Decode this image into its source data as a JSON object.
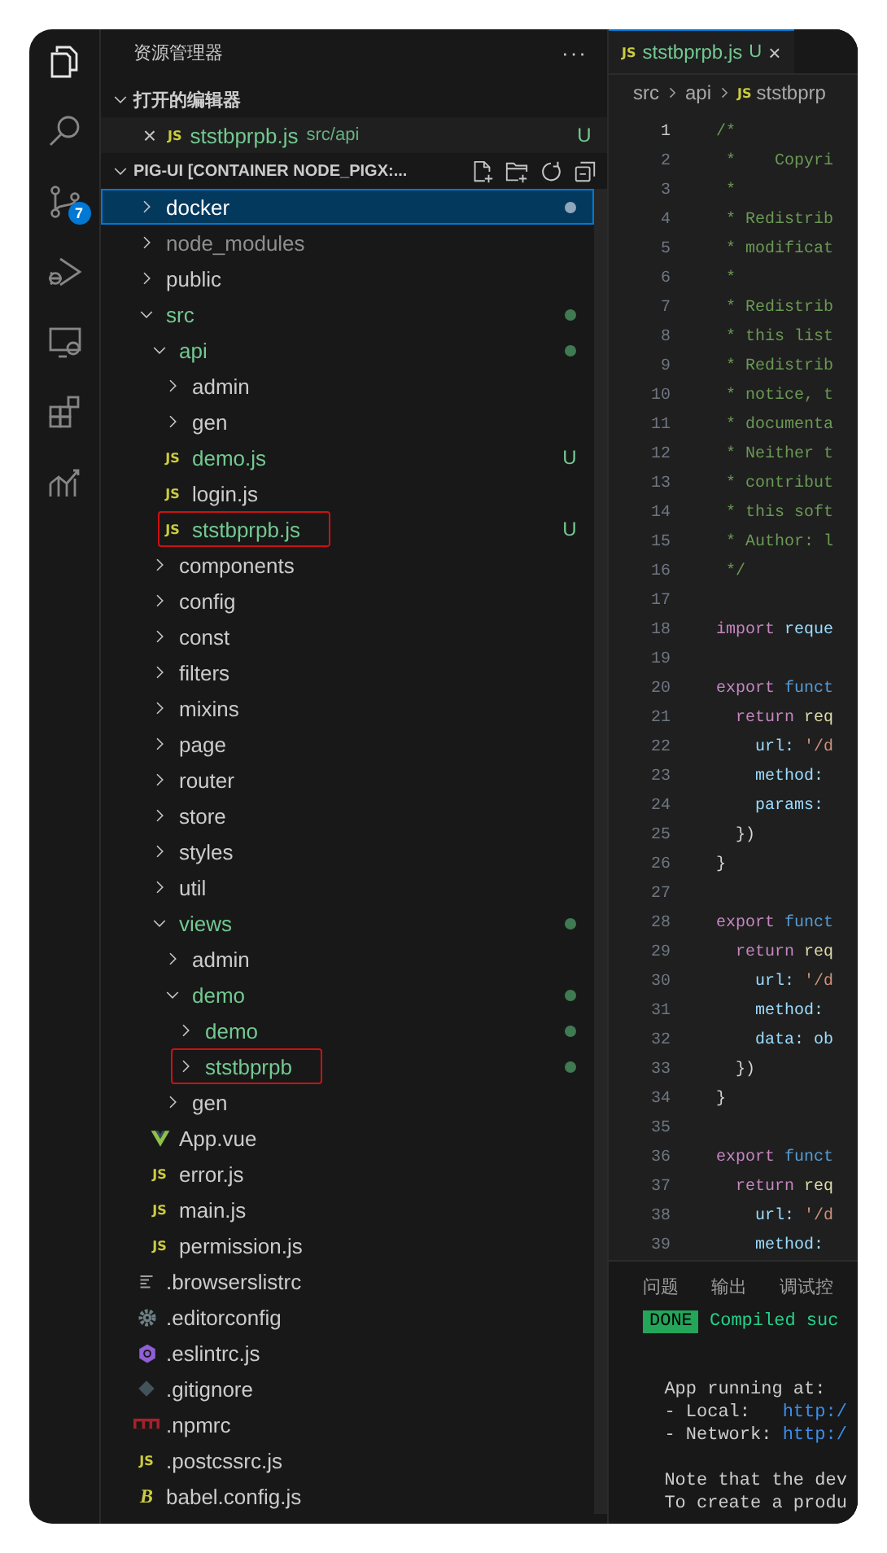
{
  "activity_bar": [
    {
      "kind": "files",
      "selected": true
    },
    {
      "kind": "search",
      "selected": false
    },
    {
      "kind": "scm",
      "selected": false,
      "badge": "7"
    },
    {
      "kind": "debug",
      "selected": false
    },
    {
      "kind": "remote",
      "selected": false
    },
    {
      "kind": "extensions",
      "selected": false
    },
    {
      "kind": "chart",
      "selected": false
    }
  ],
  "explorer": {
    "title": "资源管理器",
    "more": "···",
    "open_editors": {
      "title": "打开的编辑器",
      "expanded": true,
      "items": [
        {
          "close": "×",
          "icon_label": "JS",
          "name": "ststbprpb.js",
          "path": "src/api",
          "badge": "U"
        }
      ]
    },
    "root": {
      "title": "PIG-UI [CONTAINER NODE_PIGX:...",
      "expanded": true
    },
    "tree": [
      {
        "name": "docker",
        "kind": "folder",
        "expanded": false,
        "untracked": false,
        "ignored": false,
        "selected": true,
        "highlighted": false,
        "dot": true
      },
      {
        "name": "node_modules",
        "kind": "folder",
        "expanded": false,
        "untracked": false,
        "ignored": true,
        "selected": false,
        "highlighted": false,
        "dot": false
      },
      {
        "name": "public",
        "kind": "folder",
        "expanded": false,
        "untracked": false,
        "ignored": false,
        "selected": false,
        "highlighted": false,
        "dot": false
      },
      {
        "name": "src",
        "kind": "folder",
        "expanded": true,
        "untracked": true,
        "ignored": false,
        "selected": false,
        "highlighted": false,
        "dot": true,
        "children": [
          {
            "name": "api",
            "kind": "folder",
            "expanded": true,
            "untracked": true,
            "ignored": false,
            "selected": false,
            "highlighted": false,
            "dot": true,
            "children": [
              {
                "name": "admin",
                "kind": "folder",
                "expanded": false,
                "untracked": false,
                "ignored": false,
                "selected": false,
                "highlighted": false,
                "dot": false
              },
              {
                "name": "gen",
                "kind": "folder",
                "expanded": false,
                "untracked": false,
                "ignored": false,
                "selected": false,
                "highlighted": false,
                "dot": false
              },
              {
                "name": "demo.js",
                "kind": "js",
                "icon_label": "JS",
                "untracked": true,
                "ignored": false,
                "badge": "U",
                "selected": false,
                "highlighted": false,
                "dot": false
              },
              {
                "name": "login.js",
                "kind": "js",
                "icon_label": "JS",
                "untracked": false,
                "ignored": false,
                "selected": false,
                "highlighted": false,
                "dot": false
              },
              {
                "name": "ststbprpb.js",
                "kind": "js",
                "icon_label": "JS",
                "untracked": true,
                "ignored": false,
                "badge": "U",
                "selected": false,
                "highlighted": true,
                "dot": false
              }
            ]
          },
          {
            "name": "components",
            "kind": "folder",
            "expanded": false,
            "untracked": false,
            "ignored": false,
            "selected": false,
            "highlighted": false,
            "dot": false
          },
          {
            "name": "config",
            "kind": "folder",
            "expanded": false,
            "untracked": false,
            "ignored": false,
            "selected": false,
            "highlighted": false,
            "dot": false
          },
          {
            "name": "const",
            "kind": "folder",
            "expanded": false,
            "untracked": false,
            "ignored": false,
            "selected": false,
            "highlighted": false,
            "dot": false
          },
          {
            "name": "filters",
            "kind": "folder",
            "expanded": false,
            "untracked": false,
            "ignored": false,
            "selected": false,
            "highlighted": false,
            "dot": false
          },
          {
            "name": "mixins",
            "kind": "folder",
            "expanded": false,
            "untracked": false,
            "ignored": false,
            "selected": false,
            "highlighted": false,
            "dot": false
          },
          {
            "name": "page",
            "kind": "folder",
            "expanded": false,
            "untracked": false,
            "ignored": false,
            "selected": false,
            "highlighted": false,
            "dot": false
          },
          {
            "name": "router",
            "kind": "folder",
            "expanded": false,
            "untracked": false,
            "ignored": false,
            "selected": false,
            "highlighted": false,
            "dot": false
          },
          {
            "name": "store",
            "kind": "folder",
            "expanded": false,
            "untracked": false,
            "ignored": false,
            "selected": false,
            "highlighted": false,
            "dot": false
          },
          {
            "name": "styles",
            "kind": "folder",
            "expanded": false,
            "untracked": false,
            "ignored": false,
            "selected": false,
            "highlighted": false,
            "dot": false
          },
          {
            "name": "util",
            "kind": "folder",
            "expanded": false,
            "untracked": false,
            "ignored": false,
            "selected": false,
            "highlighted": false,
            "dot": false
          },
          {
            "name": "views",
            "kind": "folder",
            "expanded": true,
            "untracked": true,
            "ignored": false,
            "selected": false,
            "highlighted": false,
            "dot": true,
            "children": [
              {
                "name": "admin",
                "kind": "folder",
                "expanded": false,
                "untracked": false,
                "ignored": false,
                "selected": false,
                "highlighted": false,
                "dot": false
              },
              {
                "name": "demo",
                "kind": "folder",
                "expanded": true,
                "untracked": true,
                "ignored": false,
                "selected": false,
                "highlighted": false,
                "dot": true,
                "children": [
                  {
                    "name": "demo",
                    "kind": "folder",
                    "expanded": false,
                    "untracked": true,
                    "ignored": false,
                    "selected": false,
                    "highlighted": false,
                    "dot": true
                  },
                  {
                    "name": "ststbprpb",
                    "kind": "folder",
                    "expanded": false,
                    "untracked": true,
                    "ignored": false,
                    "selected": false,
                    "highlighted": true,
                    "dot": true
                  }
                ]
              },
              {
                "name": "gen",
                "kind": "folder",
                "expanded": false,
                "untracked": false,
                "ignored": false,
                "selected": false,
                "highlighted": false,
                "dot": false
              }
            ]
          },
          {
            "name": "App.vue",
            "kind": "vue",
            "untracked": false,
            "ignored": false,
            "selected": false,
            "highlighted": false,
            "dot": false
          },
          {
            "name": "error.js",
            "kind": "js",
            "icon_label": "JS",
            "untracked": false,
            "ignored": false,
            "selected": false,
            "highlighted": false,
            "dot": false
          },
          {
            "name": "main.js",
            "kind": "js",
            "icon_label": "JS",
            "untracked": false,
            "ignored": false,
            "selected": false,
            "highlighted": false,
            "dot": false
          },
          {
            "name": "permission.js",
            "kind": "js",
            "icon_label": "JS",
            "untracked": false,
            "ignored": false,
            "selected": false,
            "highlighted": false,
            "dot": false
          }
        ]
      },
      {
        "name": ".browserslistrc",
        "kind": "lines",
        "untracked": false,
        "ignored": false,
        "selected": false,
        "highlighted": false,
        "dot": false
      },
      {
        "name": ".editorconfig",
        "kind": "gear",
        "untracked": false,
        "ignored": false,
        "selected": false,
        "highlighted": false,
        "dot": false
      },
      {
        "name": ".eslintrc.js",
        "kind": "eslint",
        "untracked": false,
        "ignored": false,
        "selected": false,
        "highlighted": false,
        "dot": false
      },
      {
        "name": ".gitignore",
        "kind": "git",
        "untracked": false,
        "ignored": false,
        "selected": false,
        "highlighted": false,
        "dot": false
      },
      {
        "name": ".npmrc",
        "kind": "npm",
        "untracked": false,
        "ignored": false,
        "selected": false,
        "highlighted": false,
        "dot": false
      },
      {
        "name": ".postcssrc.js",
        "kind": "js",
        "icon_label": "JS",
        "untracked": false,
        "ignored": false,
        "selected": false,
        "highlighted": false,
        "dot": false
      },
      {
        "name": "babel.config.js",
        "kind": "babel",
        "icon_label": "B",
        "untracked": false,
        "ignored": false,
        "selected": false,
        "highlighted": false,
        "dot": false
      }
    ]
  },
  "editor": {
    "tab": {
      "icon_label": "JS",
      "name": "ststbprpb.js",
      "badge": "U",
      "close": "×",
      "selected": true
    },
    "breadcrumb": [
      {
        "kind": "text",
        "text": "src"
      },
      {
        "kind": "text",
        "text": "api"
      },
      {
        "kind": "file",
        "icon_label": "JS",
        "text": "ststbprp"
      }
    ],
    "lines": [
      {
        "num": "1",
        "current": true,
        "tokens": [
          {
            "kind": "comment",
            "text": "/*"
          }
        ]
      },
      {
        "num": "2",
        "current": false,
        "tokens": [
          {
            "kind": "comment",
            "text": " *    Copyri"
          }
        ]
      },
      {
        "num": "3",
        "current": false,
        "tokens": [
          {
            "kind": "comment",
            "text": " *"
          }
        ]
      },
      {
        "num": "4",
        "current": false,
        "tokens": [
          {
            "kind": "comment",
            "text": " * Redistrib"
          }
        ]
      },
      {
        "num": "5",
        "current": false,
        "tokens": [
          {
            "kind": "comment",
            "text": " * modificat"
          }
        ]
      },
      {
        "num": "6",
        "current": false,
        "tokens": [
          {
            "kind": "comment",
            "text": " *"
          }
        ]
      },
      {
        "num": "7",
        "current": false,
        "tokens": [
          {
            "kind": "comment",
            "text": " * Redistrib"
          }
        ]
      },
      {
        "num": "8",
        "current": false,
        "tokens": [
          {
            "kind": "comment",
            "text": " * this list"
          }
        ]
      },
      {
        "num": "9",
        "current": false,
        "tokens": [
          {
            "kind": "comment",
            "text": " * Redistrib"
          }
        ]
      },
      {
        "num": "10",
        "current": false,
        "tokens": [
          {
            "kind": "comment",
            "text": " * notice, t"
          }
        ]
      },
      {
        "num": "11",
        "current": false,
        "tokens": [
          {
            "kind": "comment",
            "text": " * documenta"
          }
        ]
      },
      {
        "num": "12",
        "current": false,
        "tokens": [
          {
            "kind": "comment",
            "text": " * Neither t"
          }
        ]
      },
      {
        "num": "13",
        "current": false,
        "tokens": [
          {
            "kind": "comment",
            "text": " * contribut"
          }
        ]
      },
      {
        "num": "14",
        "current": false,
        "tokens": [
          {
            "kind": "comment",
            "text": " * this soft"
          }
        ]
      },
      {
        "num": "15",
        "current": false,
        "tokens": [
          {
            "kind": "comment",
            "text": " * Author: l"
          }
        ]
      },
      {
        "num": "16",
        "current": false,
        "tokens": [
          {
            "kind": "comment",
            "text": " */"
          }
        ]
      },
      {
        "num": "17",
        "current": false
      },
      {
        "num": "18",
        "current": false,
        "tokens": [
          {
            "kind": "keyword",
            "text": "import"
          },
          {
            "kind": "variable",
            "text": " reque"
          }
        ]
      },
      {
        "num": "19",
        "current": false
      },
      {
        "num": "20",
        "current": false,
        "tokens": [
          {
            "kind": "keyword",
            "text": "export"
          },
          {
            "kind": "storage",
            "text": " funct"
          }
        ]
      },
      {
        "num": "21",
        "current": false,
        "tokens": [
          {
            "kind": "keyword",
            "text": "  return"
          },
          {
            "kind": "call",
            "text": " req"
          }
        ]
      },
      {
        "num": "22",
        "current": false,
        "tokens": [
          {
            "kind": "variable",
            "text": "    url:"
          },
          {
            "kind": "string",
            "text": " '/d"
          }
        ]
      },
      {
        "num": "23",
        "current": false,
        "tokens": [
          {
            "kind": "variable",
            "text": "    method:"
          }
        ]
      },
      {
        "num": "24",
        "current": false,
        "tokens": [
          {
            "kind": "variable",
            "text": "    params:"
          }
        ]
      },
      {
        "num": "25",
        "current": false,
        "tokens": [
          {
            "kind": "plain",
            "text": "  })"
          }
        ]
      },
      {
        "num": "26",
        "current": false,
        "tokens": [
          {
            "kind": "plain",
            "text": "}"
          }
        ]
      },
      {
        "num": "27",
        "current": false
      },
      {
        "num": "28",
        "current": false,
        "tokens": [
          {
            "kind": "keyword",
            "text": "export"
          },
          {
            "kind": "storage",
            "text": " funct"
          }
        ]
      },
      {
        "num": "29",
        "current": false,
        "tokens": [
          {
            "kind": "keyword",
            "text": "  return"
          },
          {
            "kind": "call",
            "text": " req"
          }
        ]
      },
      {
        "num": "30",
        "current": false,
        "tokens": [
          {
            "kind": "variable",
            "text": "    url:"
          },
          {
            "kind": "string",
            "text": " '/d"
          }
        ]
      },
      {
        "num": "31",
        "current": false,
        "tokens": [
          {
            "kind": "variable",
            "text": "    method:"
          }
        ]
      },
      {
        "num": "32",
        "current": false,
        "tokens": [
          {
            "kind": "variable",
            "text": "    data: ob"
          }
        ]
      },
      {
        "num": "33",
        "current": false,
        "tokens": [
          {
            "kind": "plain",
            "text": "  })"
          }
        ]
      },
      {
        "num": "34",
        "current": false,
        "tokens": [
          {
            "kind": "plain",
            "text": "}"
          }
        ]
      },
      {
        "num": "35",
        "current": false
      },
      {
        "num": "36",
        "current": false,
        "tokens": [
          {
            "kind": "keyword",
            "text": "export"
          },
          {
            "kind": "storage",
            "text": " funct"
          }
        ]
      },
      {
        "num": "37",
        "current": false,
        "tokens": [
          {
            "kind": "keyword",
            "text": "  return"
          },
          {
            "kind": "call",
            "text": " req"
          }
        ]
      },
      {
        "num": "38",
        "current": false,
        "tokens": [
          {
            "kind": "variable",
            "text": "    url:"
          },
          {
            "kind": "string",
            "text": " '/d"
          }
        ]
      },
      {
        "num": "39",
        "current": false,
        "tokens": [
          {
            "kind": "variable",
            "text": "    method:"
          }
        ]
      }
    ]
  },
  "panel": {
    "tabs": [
      {
        "label": "问题",
        "selected": false
      },
      {
        "label": "输出",
        "selected": false
      },
      {
        "label": "调试控",
        "selected": false
      }
    ],
    "terminal": [
      {
        "kind": "done",
        "badge": "DONE",
        "text": " Compiled suc"
      },
      {
        "kind": "blank"
      },
      {
        "kind": "blank"
      },
      {
        "kind": "text",
        "text": "  App running at:"
      },
      {
        "kind": "url",
        "text": "  - Local:   ",
        "url": "http:/"
      },
      {
        "kind": "url",
        "text": "  - Network: ",
        "url": "http:/"
      },
      {
        "kind": "blank"
      },
      {
        "kind": "text",
        "text": "  Note that the dev"
      },
      {
        "kind": "text",
        "text": "  To create a produ"
      }
    ]
  }
}
